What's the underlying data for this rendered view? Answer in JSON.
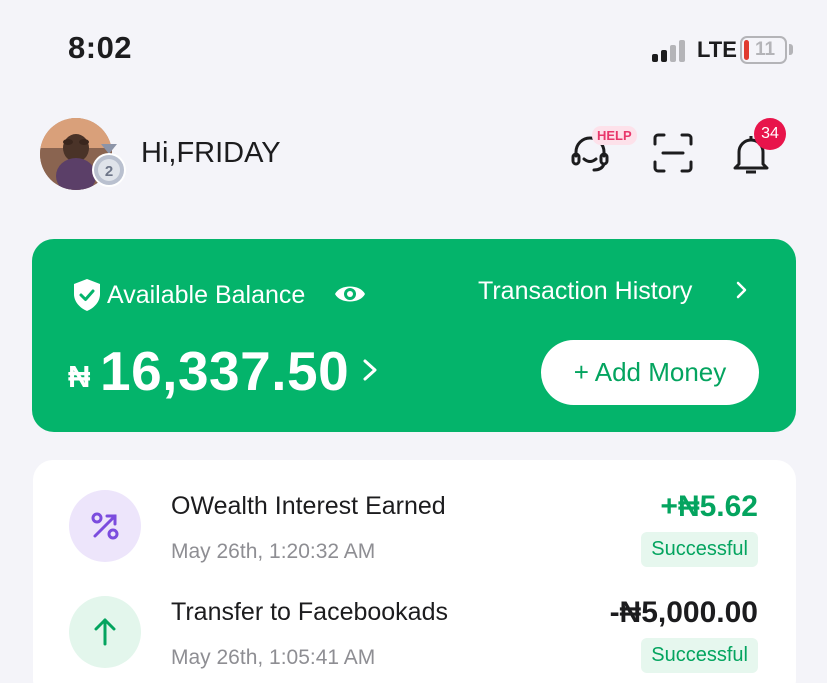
{
  "status_bar": {
    "time": "8:02",
    "network": "LTE",
    "battery": "11"
  },
  "header": {
    "greeting": "Hi,FRIDAY",
    "help_tag": "HELP",
    "notification_count": "34",
    "avatar_badge": "2"
  },
  "balance_card": {
    "label": "Available Balance",
    "history_link": "Transaction History",
    "currency_symbol": "₦",
    "amount": "16,337.50",
    "add_money": "+ Add Money",
    "color": "#04b46b"
  },
  "transactions": [
    {
      "title": "OWealth Interest Earned",
      "time": "May 26th, 1:20:32 AM",
      "amount": "+₦5.62",
      "status": "Successful",
      "icon": "percent-icon",
      "amount_color": "#04a45f"
    },
    {
      "title": "Transfer to Facebookads",
      "time": "May 26th, 1:05:41 AM",
      "amount": "-₦5,000.00",
      "status": "Successful",
      "icon": "arrow-up-icon",
      "amount_color": "#1c1c1e"
    }
  ]
}
